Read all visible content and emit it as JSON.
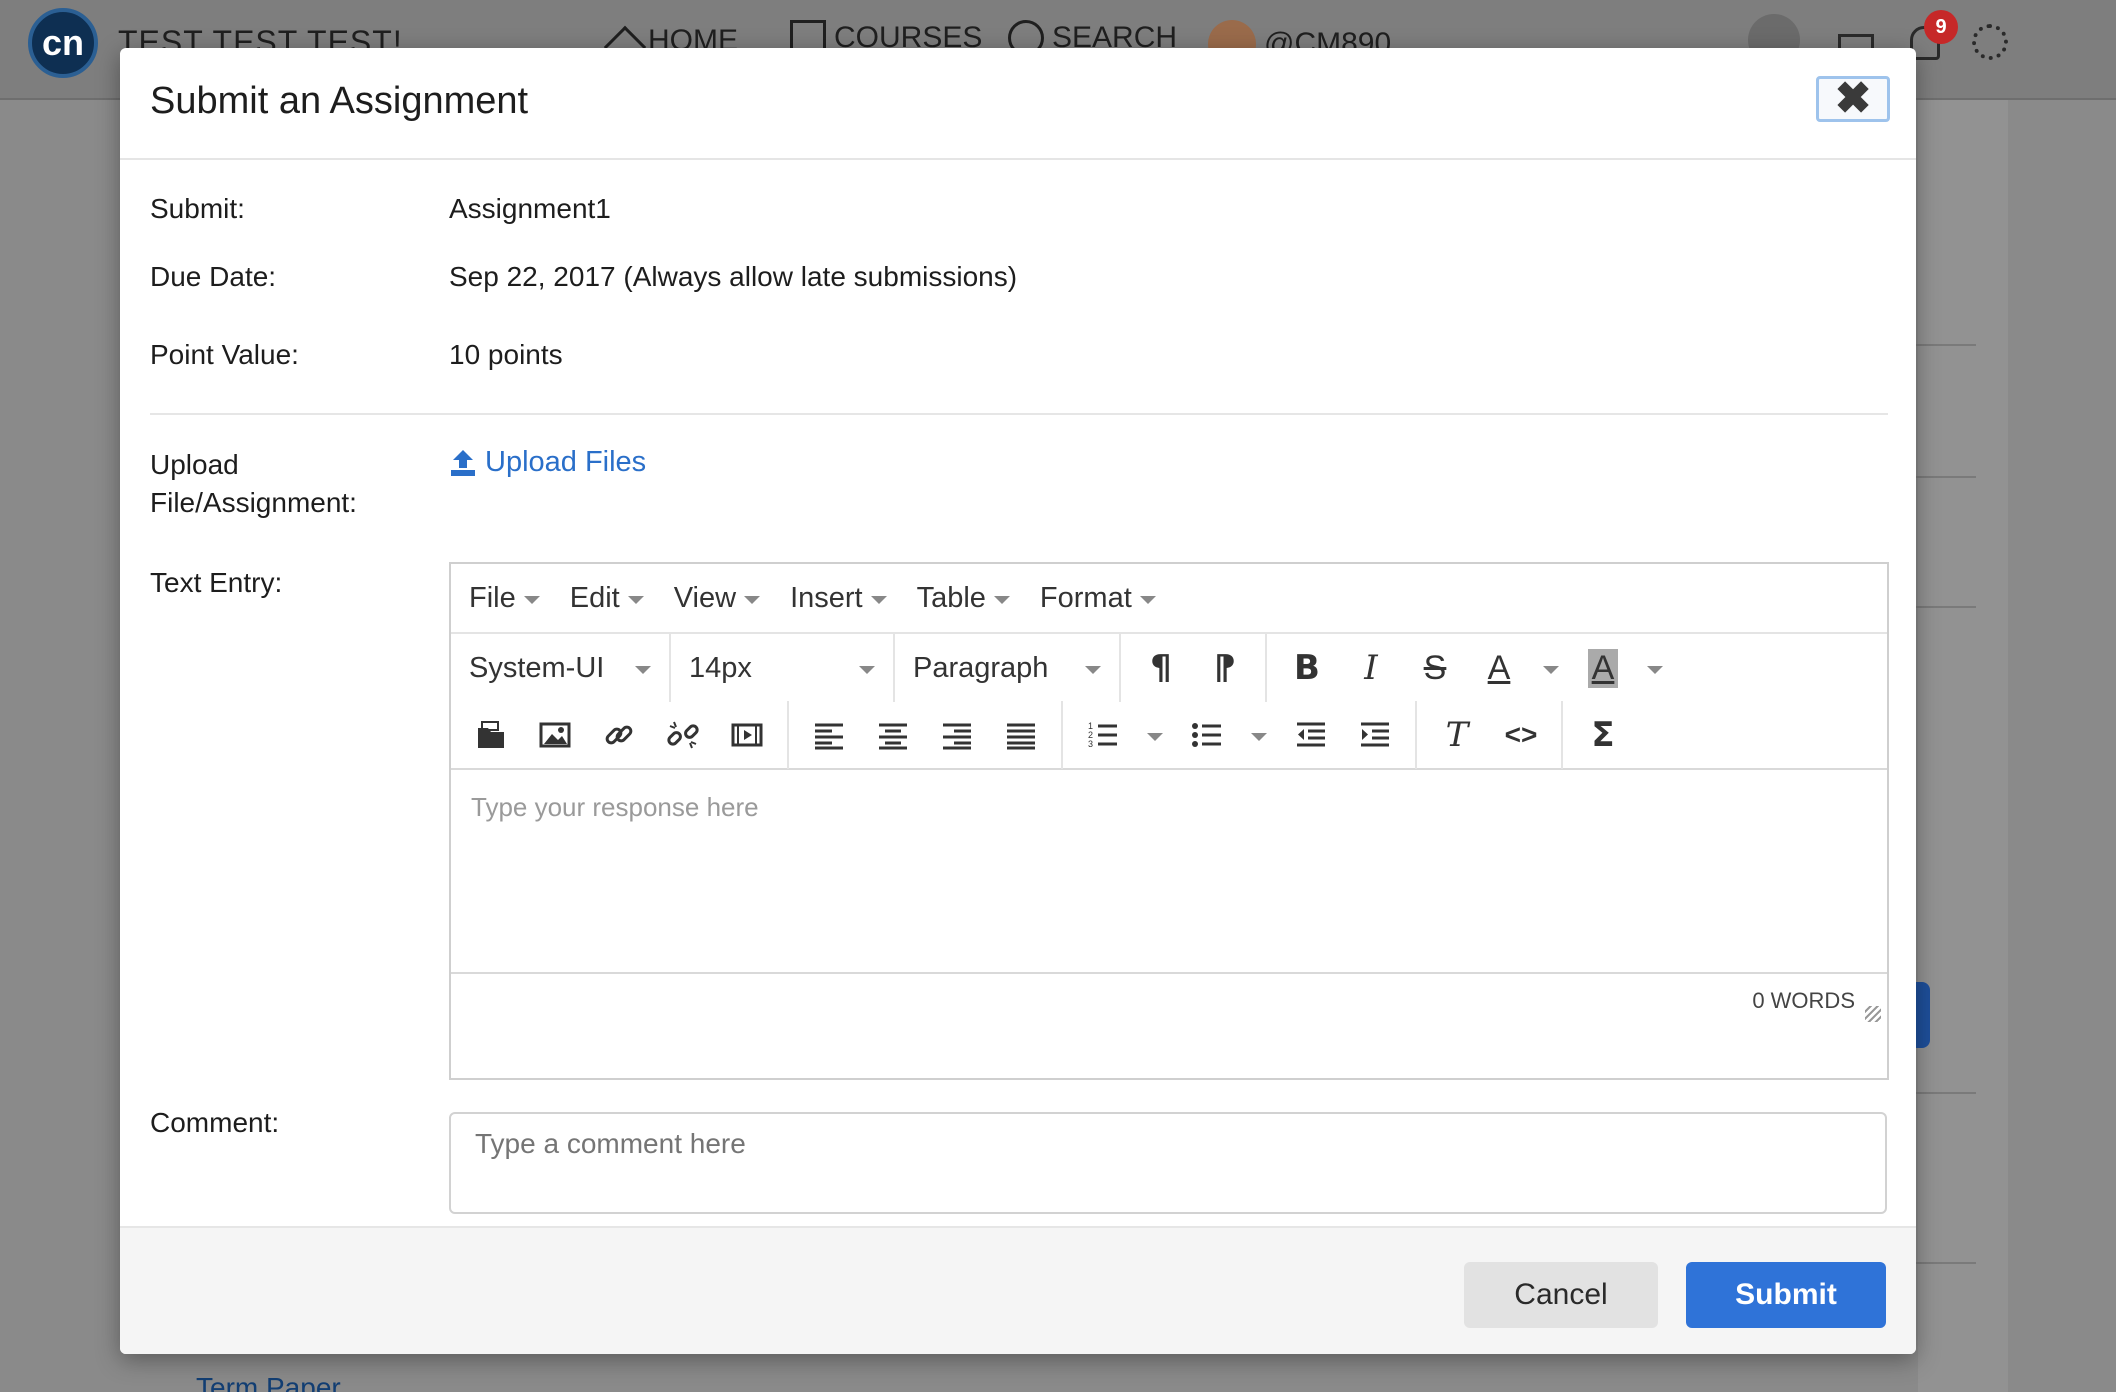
{
  "app": {
    "logo_text": "cn",
    "site_title": "TEST TEST TEST!",
    "nav": {
      "home": "HOME",
      "courses": "COURSES",
      "search": "SEARCH",
      "user": "@CM890"
    },
    "notification_count": "9",
    "bg_link": "Term Paper"
  },
  "modal": {
    "title": "Submit an Assignment",
    "close_symbol": "✖",
    "fields": {
      "submit_label": "Submit:",
      "submit_value": "Assignment1",
      "due_label": "Due Date:",
      "due_value": "Sep 22, 2017 (Always allow late submissions)",
      "points_label": "Point Value:",
      "points_value": "10 points",
      "upload_label_1": "Upload",
      "upload_label_2": "File/Assignment:",
      "upload_link": "Upload Files",
      "text_entry_label": "Text Entry:",
      "comment_label": "Comment:",
      "comment_placeholder": "Type a comment here"
    },
    "editor": {
      "menus": [
        "File",
        "Edit",
        "View",
        "Insert",
        "Table",
        "Format"
      ],
      "font_family": "System-UI",
      "font_size": "14px",
      "block_format": "Paragraph",
      "placeholder": "Type your response here",
      "word_count": "0 WORDS",
      "glyphs": {
        "ltr": "¶",
        "rtl": "¶",
        "bold": "B",
        "italic": "I",
        "strike": "S",
        "font_color": "A",
        "bg_color": "A",
        "clear_format": "T",
        "code": "<>",
        "math": "Σ"
      }
    },
    "footer": {
      "cancel": "Cancel",
      "submit": "Submit"
    }
  }
}
